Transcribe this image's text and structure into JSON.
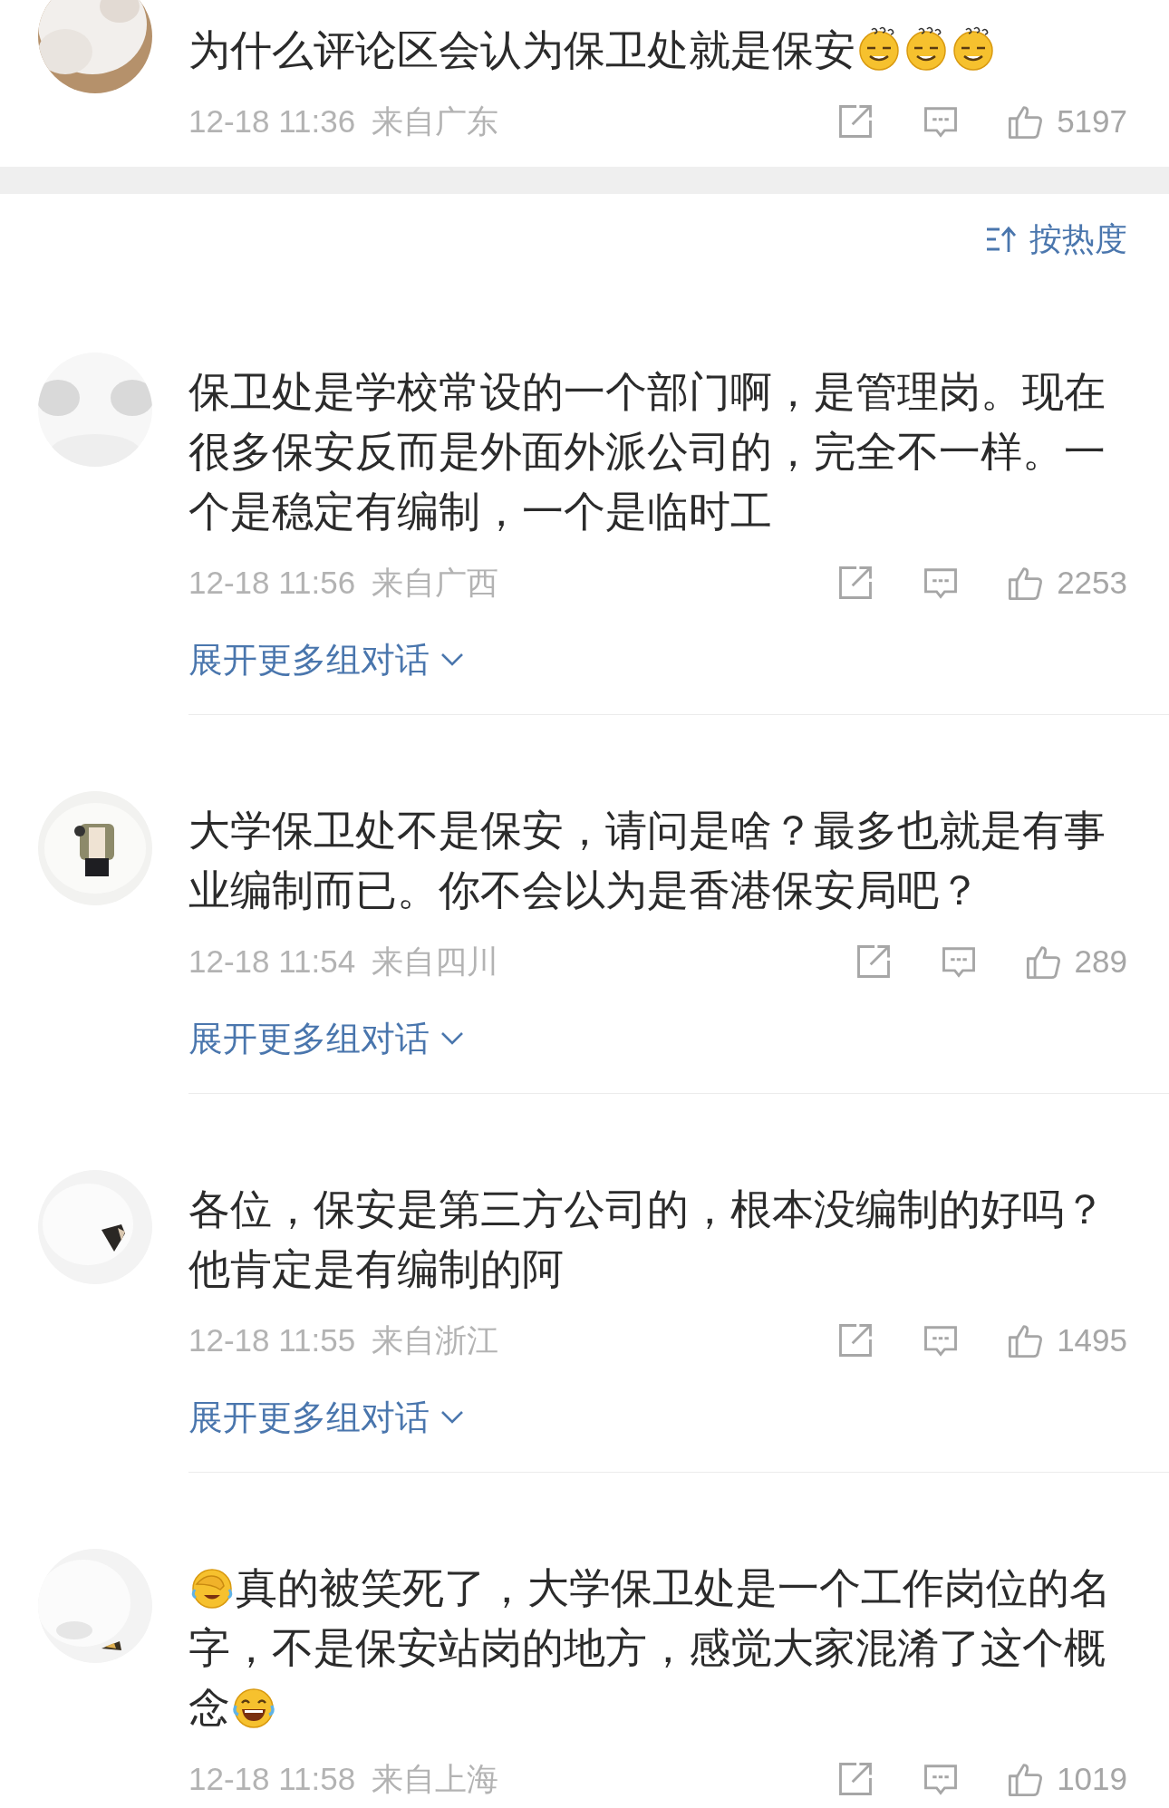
{
  "top_comment": {
    "content": [
      {
        "kind": "text",
        "text": "为什么评论区会认为保卫处就是保安"
      },
      {
        "kind": "puzzled"
      },
      {
        "kind": "puzzled"
      },
      {
        "kind": "puzzled"
      }
    ],
    "time": "12-18 11:36",
    "location": "来自广东",
    "likes": "5197"
  },
  "sort": {
    "label": "按热度"
  },
  "comments": [
    {
      "content": [
        {
          "kind": "text",
          "text": "保卫处是学校常设的一个部门啊，是管理岗。现在很多保安反而是外面外派公司的，完全不一样。一个是稳定有编制，一个是临时工"
        }
      ],
      "time": "12-18 11:56",
      "location": "来自广西",
      "likes": "2253",
      "expand": "展开更多组对话"
    },
    {
      "content": [
        {
          "kind": "text",
          "text": "大学保卫处不是保安，请问是啥？最多也就是有事业编制而已。你不会以为是香港保安局吧？"
        }
      ],
      "time": "12-18 11:54",
      "location": "来自四川",
      "likes": "289",
      "expand": "展开更多组对话"
    },
    {
      "content": [
        {
          "kind": "text",
          "text": "各位，保安是第三方公司的，根本没编制的好吗？他肯定是有编制的阿"
        }
      ],
      "time": "12-18 11:55",
      "location": "来自浙江",
      "likes": "1495",
      "expand": "展开更多组对话"
    },
    {
      "content": [
        {
          "kind": "facepalm"
        },
        {
          "kind": "text",
          "text": "真的被笑死了，大学保卫处是一个工作岗位的名"
        },
        {
          "kind": "text",
          "text": "字，不是保安站岗的地方，感觉大家混淆了这个概"
        },
        {
          "kind": "text",
          "text": "念"
        },
        {
          "kind": "laugh"
        }
      ],
      "time": "12-18 11:58",
      "location": "来自上海",
      "likes": "1019"
    }
  ]
}
